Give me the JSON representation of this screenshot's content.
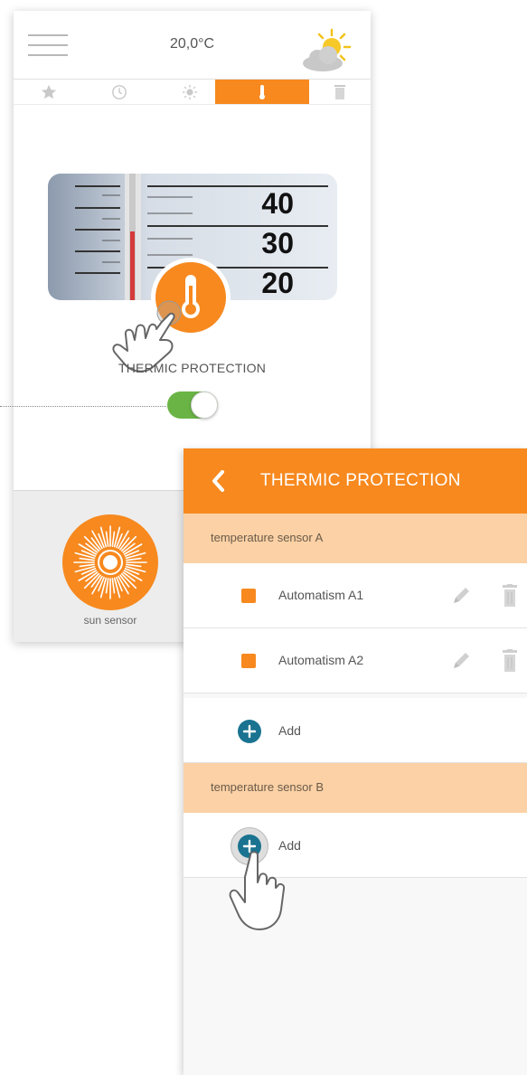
{
  "screen1": {
    "header": {
      "temperature": "20,0°C",
      "menu_icon": "hamburger-icon",
      "weather_icon": "partly-sunny-icon"
    },
    "tabs": [
      {
        "icon": "star-icon"
      },
      {
        "icon": "clock-icon"
      },
      {
        "icon": "sun-icon"
      },
      {
        "icon": "thermometer-icon",
        "active": true
      },
      {
        "icon": "trash-icon"
      }
    ],
    "thermometer_scale": [
      "40",
      "30",
      "20"
    ],
    "feature_label": "THERMIC PROTECTION",
    "toggle_on": true,
    "bottom": {
      "sun_sensor_label": "sun sensor"
    }
  },
  "screen2": {
    "title": "THERMIC PROTECTION",
    "sections": [
      {
        "name": "temperature sensor A",
        "items": [
          {
            "label": "Automatism A1"
          },
          {
            "label": "Automatism A2"
          }
        ],
        "add_label": "Add"
      },
      {
        "name": "temperature sensor B",
        "items": [],
        "add_label": "Add"
      }
    ]
  },
  "colors": {
    "accent": "#f7891f",
    "section_bg": "#fbd1a5",
    "toggle_on": "#6ab446",
    "add_button": "#1a7390"
  }
}
